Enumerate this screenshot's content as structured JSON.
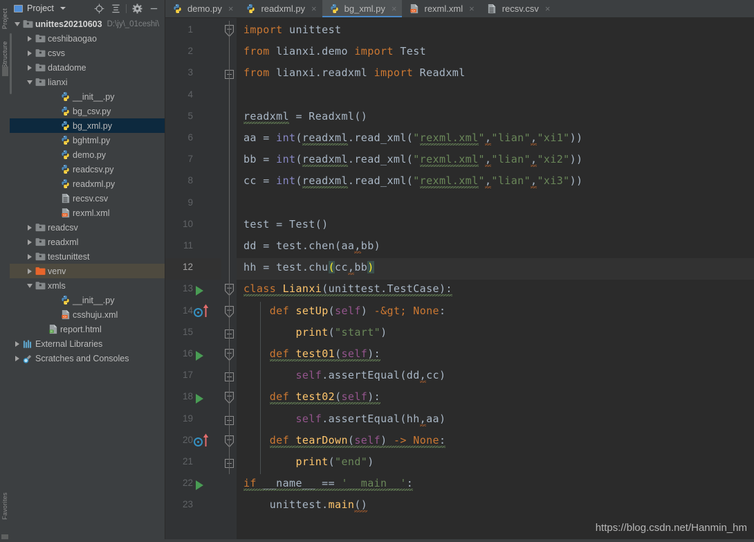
{
  "window": {
    "left_strip_tabs": [
      "Project",
      "Structure",
      "Favorites"
    ]
  },
  "project_panel": {
    "title": "Project",
    "title_icon": "project-window-icon",
    "caret_icon": "chevron-down-icon",
    "toolbar": [
      {
        "name": "locate-file-icon",
        "label": "Select Opened File"
      },
      {
        "name": "collapse-all-icon",
        "label": "Collapse All"
      },
      {
        "name": "gear-icon",
        "label": "Settings"
      },
      {
        "name": "minimize-icon",
        "label": "Hide"
      }
    ],
    "tree": [
      {
        "label": "unittes20210603",
        "path": "D:\\jy\\_01ceshi\\",
        "indent": 0,
        "toggle": "down",
        "icon": "folder-icon",
        "bold": true,
        "state": "normal"
      },
      {
        "label": "ceshibaogao",
        "path": "",
        "indent": 1,
        "toggle": "right",
        "icon": "folder-icon",
        "bold": false,
        "state": "normal"
      },
      {
        "label": "csvs",
        "path": "",
        "indent": 1,
        "toggle": "right",
        "icon": "folder-icon",
        "bold": false,
        "state": "normal"
      },
      {
        "label": "datadome",
        "path": "",
        "indent": 1,
        "toggle": "right",
        "icon": "folder-icon",
        "bold": false,
        "state": "normal"
      },
      {
        "label": "lianxi",
        "path": "",
        "indent": 1,
        "toggle": "down",
        "icon": "folder-icon",
        "bold": false,
        "state": "normal"
      },
      {
        "label": "__init__.py",
        "path": "",
        "indent": 3,
        "toggle": "none",
        "icon": "python-file-icon",
        "bold": false,
        "state": "normal"
      },
      {
        "label": "bg_csv.py",
        "path": "",
        "indent": 3,
        "toggle": "none",
        "icon": "python-file-icon",
        "bold": false,
        "state": "normal"
      },
      {
        "label": "bg_xml.py",
        "path": "",
        "indent": 3,
        "toggle": "none",
        "icon": "python-file-icon",
        "bold": false,
        "state": "selected"
      },
      {
        "label": "bghtml.py",
        "path": "",
        "indent": 3,
        "toggle": "none",
        "icon": "python-file-icon",
        "bold": false,
        "state": "normal"
      },
      {
        "label": "demo.py",
        "path": "",
        "indent": 3,
        "toggle": "none",
        "icon": "python-file-icon",
        "bold": false,
        "state": "normal"
      },
      {
        "label": "readcsv.py",
        "path": "",
        "indent": 3,
        "toggle": "none",
        "icon": "python-file-icon",
        "bold": false,
        "state": "normal"
      },
      {
        "label": "readxml.py",
        "path": "",
        "indent": 3,
        "toggle": "none",
        "icon": "python-file-icon",
        "bold": false,
        "state": "normal"
      },
      {
        "label": "recsv.csv",
        "path": "",
        "indent": 3,
        "toggle": "none",
        "icon": "csv-file-icon",
        "bold": false,
        "state": "normal"
      },
      {
        "label": "rexml.xml",
        "path": "",
        "indent": 3,
        "toggle": "none",
        "icon": "xml-file-icon",
        "bold": false,
        "state": "normal"
      },
      {
        "label": "readcsv",
        "path": "",
        "indent": 1,
        "toggle": "right",
        "icon": "folder-icon",
        "bold": false,
        "state": "normal"
      },
      {
        "label": "readxml",
        "path": "",
        "indent": 1,
        "toggle": "right",
        "icon": "folder-icon",
        "bold": false,
        "state": "normal"
      },
      {
        "label": "testunittest",
        "path": "",
        "indent": 1,
        "toggle": "right",
        "icon": "folder-icon",
        "bold": false,
        "state": "normal"
      },
      {
        "label": "venv",
        "path": "",
        "indent": 1,
        "toggle": "right",
        "icon": "venv-folder-icon",
        "bold": false,
        "state": "selected-inactive"
      },
      {
        "label": "xmls",
        "path": "",
        "indent": 1,
        "toggle": "down",
        "icon": "folder-icon",
        "bold": false,
        "state": "normal"
      },
      {
        "label": "__init__.py",
        "path": "",
        "indent": 3,
        "toggle": "none",
        "icon": "python-file-icon",
        "bold": false,
        "state": "normal"
      },
      {
        "label": "csshuju.xml",
        "path": "",
        "indent": 3,
        "toggle": "none",
        "icon": "xml-file-icon",
        "bold": false,
        "state": "normal"
      },
      {
        "label": "report.html",
        "path": "",
        "indent": 2,
        "toggle": "none",
        "icon": "html-file-icon",
        "bold": false,
        "state": "normal"
      },
      {
        "label": "External Libraries",
        "path": "",
        "indent": 0,
        "toggle": "right",
        "icon": "library-icon",
        "bold": false,
        "state": "normal"
      },
      {
        "label": "Scratches and Consoles",
        "path": "",
        "indent": 0,
        "toggle": "right",
        "icon": "scratches-icon",
        "bold": false,
        "state": "normal"
      }
    ]
  },
  "editor_tabs": [
    {
      "label": "demo.py",
      "icon": "python-file-icon",
      "active": false
    },
    {
      "label": "readxml.py",
      "icon": "python-file-icon",
      "active": false
    },
    {
      "label": "bg_xml.py",
      "icon": "python-file-icon",
      "active": true
    },
    {
      "label": "rexml.xml",
      "icon": "xml-file-icon",
      "active": false
    },
    {
      "label": "recsv.csv",
      "icon": "csv-file-icon",
      "active": false
    }
  ],
  "editor": {
    "active_line": 12,
    "lines": [
      {
        "n": 1,
        "gutter": "none",
        "fold": "fold-top"
      },
      {
        "n": 2,
        "gutter": "none",
        "fold": "none"
      },
      {
        "n": 3,
        "gutter": "none",
        "fold": "fold-bottom"
      },
      {
        "n": 4,
        "gutter": "none",
        "fold": "none"
      },
      {
        "n": 5,
        "gutter": "none",
        "fold": "none"
      },
      {
        "n": 6,
        "gutter": "none",
        "fold": "none"
      },
      {
        "n": 7,
        "gutter": "none",
        "fold": "none"
      },
      {
        "n": 8,
        "gutter": "none",
        "fold": "none"
      },
      {
        "n": 9,
        "gutter": "none",
        "fold": "none"
      },
      {
        "n": 10,
        "gutter": "none",
        "fold": "none"
      },
      {
        "n": 11,
        "gutter": "none",
        "fold": "none"
      },
      {
        "n": 12,
        "gutter": "none",
        "fold": "none"
      },
      {
        "n": 13,
        "gutter": "run",
        "fold": "fold-top"
      },
      {
        "n": 14,
        "gutter": "override",
        "fold": "fold-top"
      },
      {
        "n": 15,
        "gutter": "none",
        "fold": "fold-bottom"
      },
      {
        "n": 16,
        "gutter": "run",
        "fold": "fold-top"
      },
      {
        "n": 17,
        "gutter": "none",
        "fold": "fold-bottom"
      },
      {
        "n": 18,
        "gutter": "run",
        "fold": "fold-top"
      },
      {
        "n": 19,
        "gutter": "none",
        "fold": "fold-bottom"
      },
      {
        "n": 20,
        "gutter": "override",
        "fold": "fold-top"
      },
      {
        "n": 21,
        "gutter": "none",
        "fold": "fold-bottom"
      },
      {
        "n": 22,
        "gutter": "run",
        "fold": "none"
      },
      {
        "n": 23,
        "gutter": "none",
        "fold": "none"
      }
    ],
    "source_lines": [
      "import unittest",
      "from lianxi.demo import Test",
      "from lianxi.readxml import Readxml",
      "",
      "readxml = Readxml()",
      "aa = int(readxml.read_xml(\"rexml.xml\",\"lian\",\"xi1\"))",
      "bb = int(readxml.read_xml(\"rexml.xml\",\"lian\",\"xi2\"))",
      "cc = int(readxml.read_xml(\"rexml.xml\",\"lian\",\"xi3\"))",
      "",
      "test = Test()",
      "dd = test.chen(aa,bb)",
      "hh = test.chu(cc,bb)",
      "class Lianxi(unittest.TestCase):",
      "    def setUp(self) -> None:",
      "        print(\"start\")",
      "    def test01(self):",
      "        self.assertEqual(dd,cc)",
      "    def test02(self):",
      "        self.assertEqual(hh,aa)",
      "    def tearDown(self) -> None:",
      "        print(\"end\")",
      "if __name__ == '__main__':",
      "    unittest.main()"
    ]
  },
  "watermark": "https://blog.csdn.net/Hanmin_hm",
  "colors": {
    "editor_bg": "#2B2B2B",
    "panel_bg": "#3C3F41",
    "gutter_bg": "#313335",
    "selection": "#0D293E",
    "selection_inactive": "#4E4A3F",
    "tab_active_underline": "#4A88C7",
    "keyword": "#CC7832",
    "string": "#6A8759",
    "function": "#FFC66D",
    "builtin": "#8888C6",
    "self": "#94558D",
    "text": "#A9B7C6",
    "run_marker": "#499C54",
    "override_marker": "#3592C4"
  }
}
